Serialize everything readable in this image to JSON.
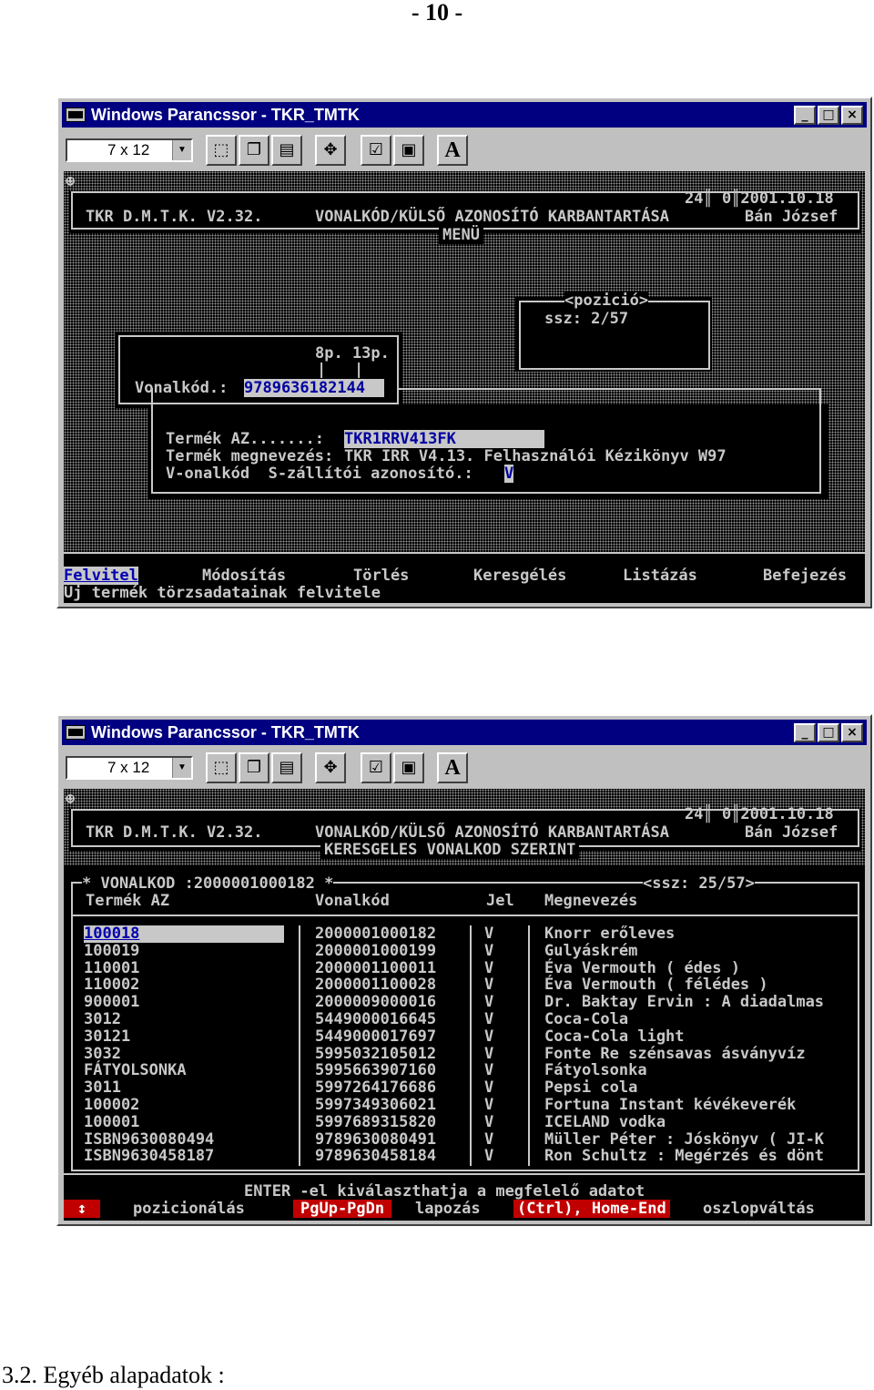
{
  "page": {
    "number": "- 10 -",
    "footer_heading": "3.2. Egyéb alapadatok :"
  },
  "window": {
    "title": "Windows Parancssor - TKR_TMTK",
    "font_size": "7 x 12",
    "buttons": {
      "minimize": "_",
      "maximize": "□",
      "close": "×"
    }
  },
  "screen1": {
    "header_left": "TKR D.M.T.K. V2.32.",
    "header_center": "VONALKÓD/KÜLSŐ AZONOSÍTÓ KARBANTARTÁSA",
    "header_stats": "24║ 0║2001.10.18",
    "header_user": "Bán József",
    "menu_label": "MENÜ",
    "position_label": "<pozició>",
    "position_value": "ssz: 2/57",
    "pages_label": "8p. 13p.",
    "barcode_label": "Vonalkód.: ",
    "barcode_value": "9789636182144",
    "product_id_label": "Termék AZ.......: ",
    "product_id_value": "TKR1RRV413FK",
    "product_name_label": "Termék megnevezés:",
    "product_name_value": "TKR IRR V4.13. Felhasználói Kézikönyv W97",
    "type_label": "V-onalkód  S-zállítói azonosító.: ",
    "type_value": "V",
    "menu_items": [
      "Felvitel",
      "Módosítás",
      "Törlés",
      "Keresgélés",
      "Listázás",
      "Befejezés"
    ],
    "status_text": "Új termék törzsadatainak felvitele"
  },
  "screen2": {
    "header_left": "TKR D.M.T.K. V2.32.",
    "header_center": "VONALKÓD/KÜLSŐ AZONOSÍTÓ KARBANTARTÁSA",
    "header_stats": "24║ 0║2001.10.18",
    "header_user": "Bán József",
    "subtitle": "KERESGELES VONALKOD SZERINT",
    "search_label": "* VONALKOD :2000001000182 *",
    "ssz": "<ssz: 25/57>",
    "columns": [
      "Termék AZ",
      "Vonalkód",
      "Jel",
      "Megnevezés"
    ],
    "rows": [
      [
        "100018",
        "2000001000182",
        "V",
        "Knorr erőleves"
      ],
      [
        "100019",
        "2000001000199",
        "V",
        "Gulyáskrém"
      ],
      [
        "110001",
        "2000001100011",
        "V",
        "Éva Vermouth ( édes )"
      ],
      [
        "110002",
        "2000001100028",
        "V",
        "Éva Vermouth ( félédes )"
      ],
      [
        "900001",
        "2000009000016",
        "V",
        "Dr. Baktay Ervin : A diadalmas"
      ],
      [
        "3012",
        "5449000016645",
        "V",
        "Coca-Cola"
      ],
      [
        "30121",
        "5449000017697",
        "V",
        "Coca-Cola light"
      ],
      [
        "3032",
        "5995032105012",
        "V",
        "Fonte Re szénsavas ásványvíz"
      ],
      [
        "FÁTYOLSONKA",
        "5995663907160",
        "V",
        "Fátyolsonka"
      ],
      [
        "3011",
        "5997264176686",
        "V",
        "Pepsi cola"
      ],
      [
        "100002",
        "5997349306021",
        "V",
        "Fortuna Instant kévékeverék"
      ],
      [
        "100001",
        "5997689315820",
        "V",
        "ICELAND vodka"
      ],
      [
        "ISBN9630080494",
        "9789630080491",
        "V",
        "Müller Péter : Jóskönyv ( JI-K"
      ],
      [
        "ISBN9630458187",
        "9789630458184",
        "V",
        "Ron Schultz : Megérzés és dönt"
      ]
    ],
    "hint": "ENTER -el kiválaszthatja a megfelelő adatot",
    "keys": [
      {
        "key": "↕",
        "desc": "pozicionálás"
      },
      {
        "key": "PgUp-PgDn",
        "desc": "lapozás"
      },
      {
        "key": "(Ctrl), Home-End",
        "desc": "oszlopváltás"
      }
    ]
  }
}
